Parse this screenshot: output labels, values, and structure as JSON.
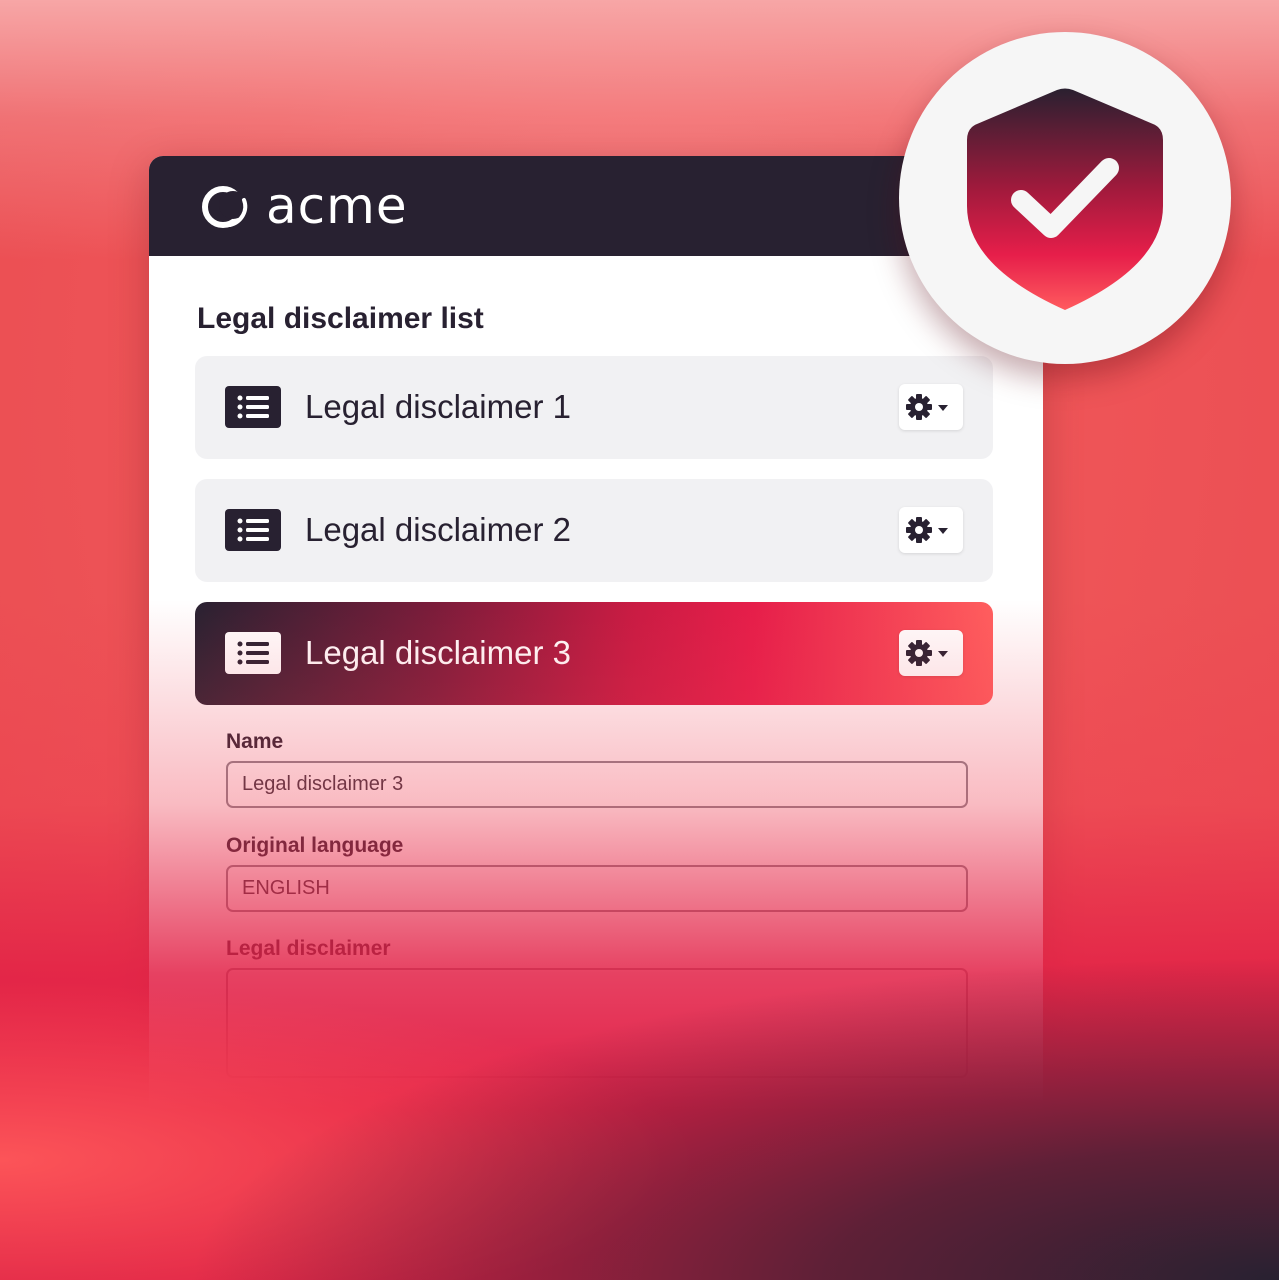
{
  "brand": {
    "name": "acme"
  },
  "page": {
    "title": "Legal disclaimer list"
  },
  "items": [
    {
      "label": "Legal disclaimer 1",
      "active": false
    },
    {
      "label": "Legal disclaimer 2",
      "active": false
    },
    {
      "label": "Legal disclaimer 3",
      "active": true
    }
  ],
  "form": {
    "name_label": "Name",
    "name_value": "Legal disclaimer 3",
    "language_label": "Original language",
    "language_value": "ENGLISH",
    "disclaimer_label": "Legal disclaimer",
    "disclaimer_value": ""
  },
  "icons": {
    "logo": "acme-logo-icon",
    "list": "list-icon",
    "gear": "gear-icon",
    "dropdown": "caret-down-icon",
    "shield": "shield-check-icon"
  },
  "colors": {
    "dark": "#282131",
    "accent": "#e61e4a",
    "accent_light": "#ff5e5e",
    "item_bg": "#f1f1f3"
  }
}
